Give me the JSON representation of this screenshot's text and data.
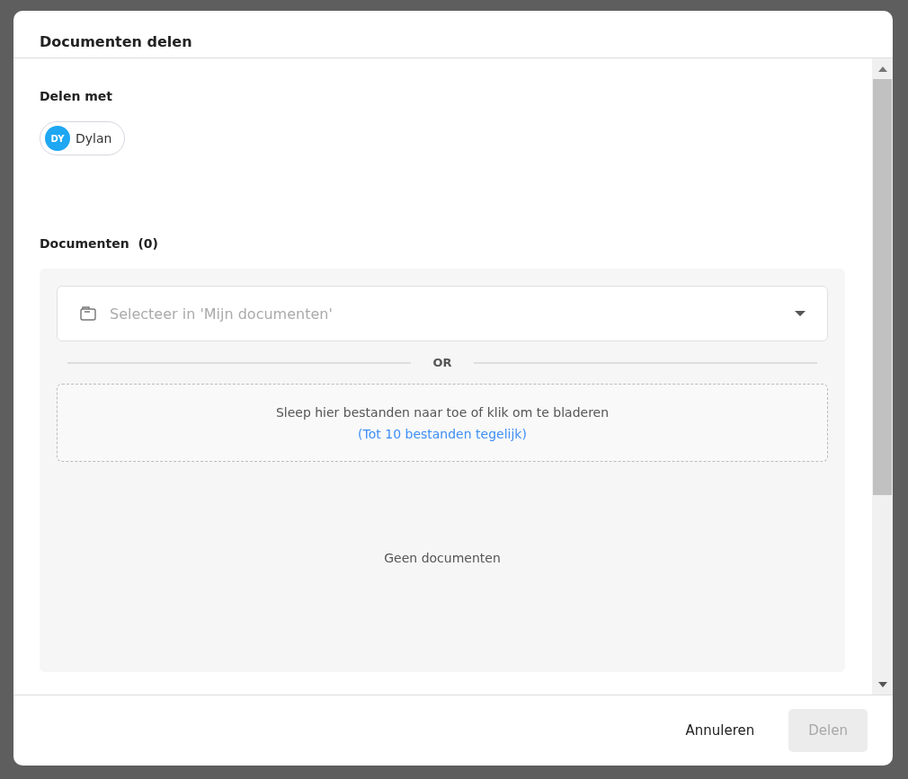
{
  "dialog": {
    "title": "Documenten delen"
  },
  "share_with": {
    "label": "Delen met",
    "recipients": [
      {
        "initials": "DY",
        "name": "Dylan",
        "color": "#1ea7f2"
      }
    ]
  },
  "documents": {
    "label": "Documenten",
    "count": "(0)",
    "select": {
      "placeholder": "Selecteer in 'Mijn documenten'"
    },
    "divider_text": "OR",
    "dropzone": {
      "text": "Sleep hier bestanden naar toe of klik om te bladeren",
      "hint": "(Tot 10 bestanden tegelijk)"
    },
    "empty_text": "Geen documenten"
  },
  "buttons": [
    {
      "label": "Annuleren",
      "kind": "text",
      "disabled": false
    },
    {
      "label": "Delen",
      "kind": "primary",
      "disabled": true
    }
  ]
}
